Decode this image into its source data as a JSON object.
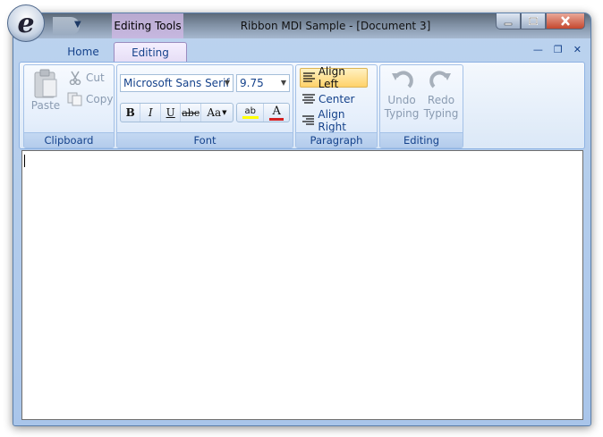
{
  "window": {
    "title": "Ribbon MDI Sample - [Document 3]",
    "context_tab_header": "Editing Tools"
  },
  "tabs": [
    {
      "label": "Home"
    },
    {
      "label": "Editing"
    }
  ],
  "clipboard": {
    "group_label": "Clipboard",
    "paste_label": "Paste",
    "cut_label": "Cut",
    "copy_label": "Copy"
  },
  "font": {
    "group_label": "Font",
    "font_family_value": "Microsoft Sans Serif",
    "font_size_value": "9.75",
    "bold_glyph": "B",
    "italic_glyph": "I",
    "underline_glyph": "U",
    "strikethrough_glyph": "abc",
    "change_case_glyph": "Aa",
    "highlight_glyph": "ab",
    "font_color_glyph": "A"
  },
  "paragraph": {
    "group_label": "Paragraph",
    "align_left_label": "Align Left",
    "center_label": "Center",
    "align_right_label": "Align Right"
  },
  "editing": {
    "group_label": "Editing",
    "undo_label_1": "Undo",
    "undo_label_2": "Typing",
    "redo_label_1": "Redo",
    "redo_label_2": "Typing"
  },
  "colors": {
    "ribbon_text": "#15428b",
    "active_button": "#ffd26a",
    "disabled_text": "#8a9bb1"
  }
}
